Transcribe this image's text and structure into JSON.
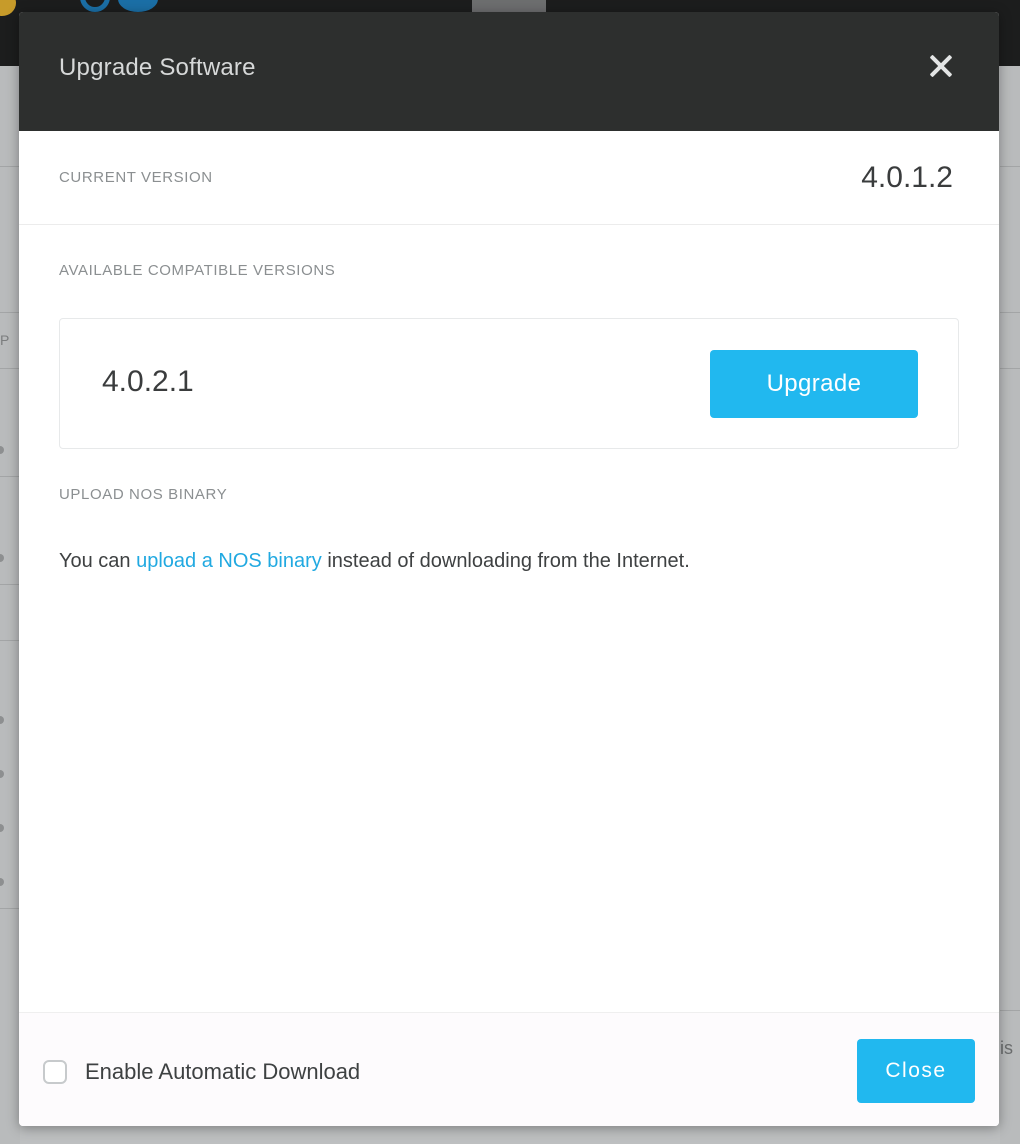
{
  "modal": {
    "title": "Upgrade Software",
    "current_version_label": "CURRENT VERSION",
    "current_version_value": "4.0.1.2",
    "available_label": "AVAILABLE COMPATIBLE VERSIONS",
    "available_versions": [
      {
        "version": "4.0.2.1",
        "action_label": "Upgrade"
      }
    ],
    "upload_label": "UPLOAD NOS BINARY",
    "upload_text_before": "You can ",
    "upload_link": "upload a NOS binary",
    "upload_text_after": " instead of downloading from the Internet.",
    "auto_download_label": "Enable Automatic Download",
    "auto_download_checked": false,
    "close_label": "Close"
  },
  "background": {
    "left_letter": "P",
    "right_text": "is"
  },
  "colors": {
    "header_bg": "#2d2f2e",
    "accent": "#21b8ef",
    "link": "#21a9e1"
  }
}
